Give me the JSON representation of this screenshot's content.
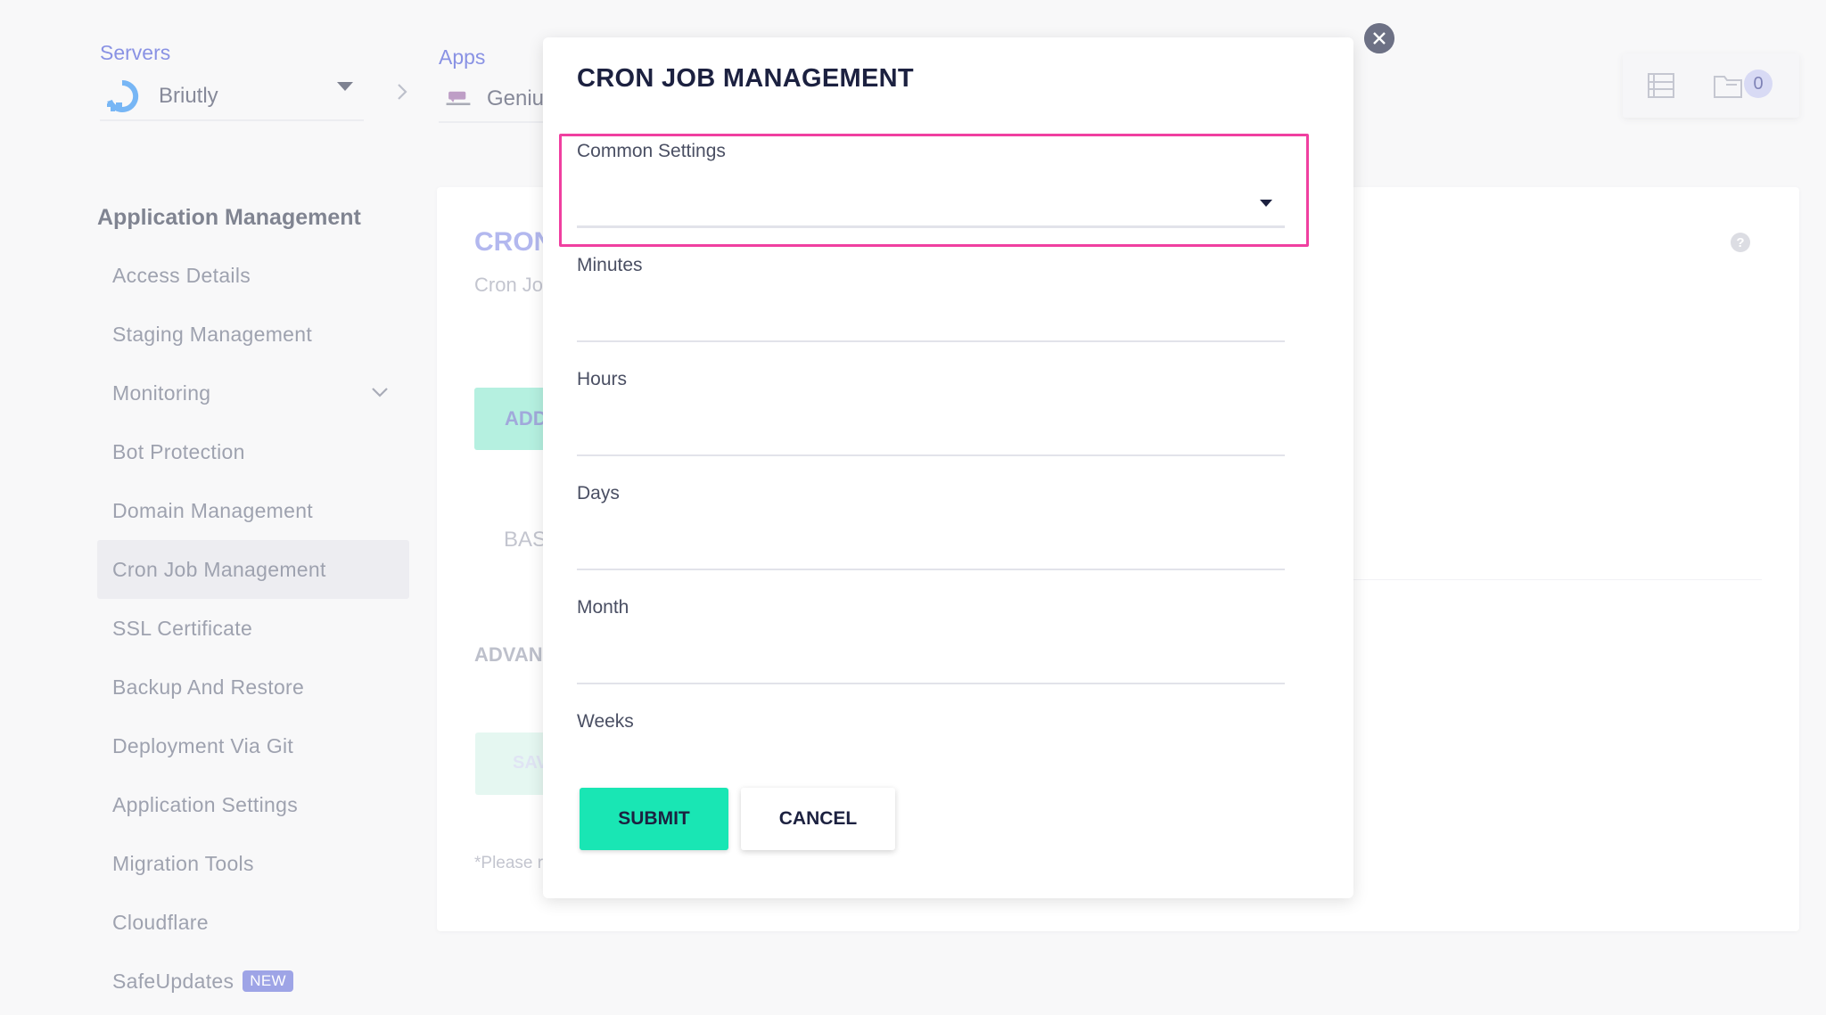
{
  "header": {
    "servers_label": "Servers",
    "server_name": "Briutly",
    "apps_label": "Apps",
    "app_name": "Genius"
  },
  "top_icons": {
    "list_icon": "list-icon",
    "folder_icon": "folder-icon",
    "count": "0"
  },
  "sidebar": {
    "heading": "Application Management",
    "items": [
      {
        "label": "Access Details"
      },
      {
        "label": "Staging Management"
      },
      {
        "label": "Monitoring"
      },
      {
        "label": "Bot Protection"
      },
      {
        "label": "Domain Management"
      },
      {
        "label": "Cron Job Management"
      },
      {
        "label": "SSL Certificate"
      },
      {
        "label": "Backup And Restore"
      },
      {
        "label": "Deployment Via Git"
      },
      {
        "label": "Application Settings"
      },
      {
        "label": "Migration Tools"
      },
      {
        "label": "Cloudflare"
      },
      {
        "label": "SafeUpdates"
      }
    ],
    "new_badge": "NEW"
  },
  "background": {
    "title": "CRON",
    "subtitle": "Cron Jo",
    "add_label": "ADD",
    "basic_label": "BAS",
    "advanced_label": "ADVAN",
    "save_label": "SAV",
    "note": "*Please r"
  },
  "modal": {
    "title": "CRON JOB MANAGEMENT",
    "common_settings_label": "Common Settings",
    "common_settings_value": "",
    "minutes_label": "Minutes",
    "minutes_value": "",
    "hours_label": "Hours",
    "hours_value": "",
    "days_label": "Days",
    "days_value": "",
    "month_label": "Month",
    "month_value": "",
    "weeks_label": "Weeks",
    "submit_label": "SUBMIT",
    "cancel_label": "CANCEL"
  },
  "colors": {
    "accent": "#4b58d6",
    "submit": "#19e6b4",
    "highlight": "#f03fa0",
    "title": "#1c2140"
  }
}
